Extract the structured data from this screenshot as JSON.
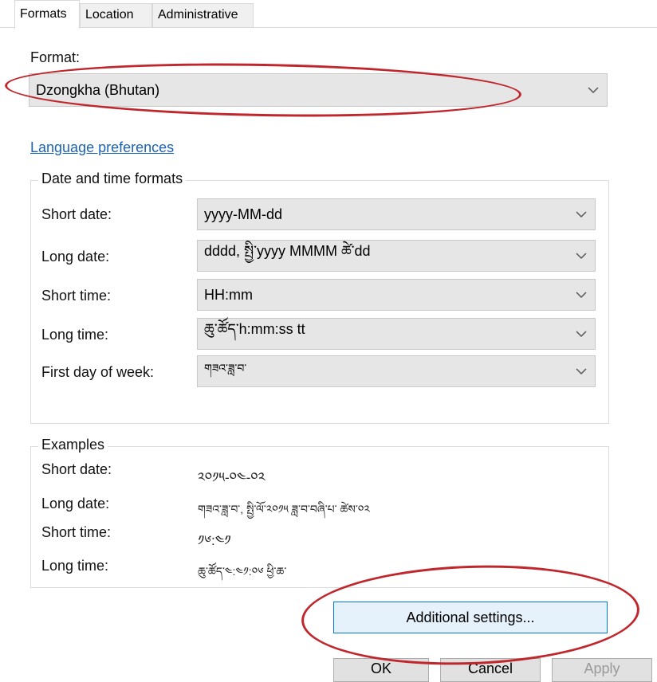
{
  "tabs": [
    {
      "label": "Formats"
    },
    {
      "label": "Location"
    },
    {
      "label": "Administrative"
    }
  ],
  "format": {
    "label": "Format:",
    "value": "Dzongkha (Bhutan)"
  },
  "language_link": "Language preferences",
  "date_time_group": {
    "title": "Date and time formats",
    "rows": [
      {
        "label": "Short date:",
        "value": "yyyy-MM-dd"
      },
      {
        "label": "Long date:",
        "value": "dddd, སྤྱི་yyyy MMMM ཚེ་dd"
      },
      {
        "label": "Short time:",
        "value": "HH:mm"
      },
      {
        "label": "Long time:",
        "value": "ཆུ་ཚོད་h:mm:ss tt"
      },
      {
        "label": "First day of week:",
        "value": "གཟའ་ཟླ་བ་"
      }
    ]
  },
  "examples_group": {
    "title": "Examples",
    "rows": [
      {
        "label": "Short date:",
        "value": "༢༠༡༥-༠༤-༠༢"
      },
      {
        "label": "Long date:",
        "value": "གཟའ་ཟླ་བ་, སྤྱི་ལོ་༢༠༡༥ ཟླ་བ་བཞི་པ་ ཚེས་༠༢"
      },
      {
        "label": "Short time:",
        "value": "༡༦:༤༡"
      },
      {
        "label": "Long time:",
        "value": "ཆུ་ཚོད་༤:༤༡:༠༦ ཕྱི་ཆ་"
      }
    ]
  },
  "additional_settings_button": "Additional settings...",
  "footer_buttons": {
    "ok": "OK",
    "cancel": "Cancel",
    "apply": "Apply"
  },
  "colors": {
    "annotation": "#c0272d",
    "link": "#1a63b8",
    "accent": "#0078d7"
  },
  "icons": {
    "combo": "chevron-down-icon"
  }
}
